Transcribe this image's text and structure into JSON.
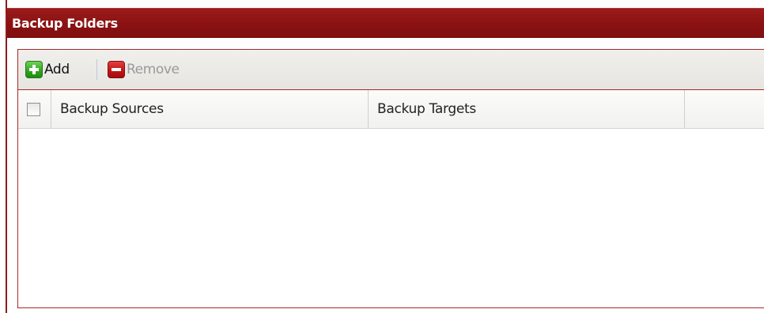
{
  "panel": {
    "title": "Backup Folders"
  },
  "toolbar": {
    "add_label": "Add",
    "add_icon": "plus-icon",
    "remove_label": "Remove",
    "remove_icon": "minus-icon",
    "remove_enabled": false
  },
  "grid": {
    "columns": [
      "Backup Sources",
      "Backup Targets",
      ""
    ],
    "select_all_checked": false,
    "rows": []
  },
  "colors": {
    "header_red": "#8c1212",
    "border_red": "#a62a2a",
    "add_green": "#35a520",
    "remove_red": "#c21616",
    "disabled_text": "#9a9a9a"
  }
}
